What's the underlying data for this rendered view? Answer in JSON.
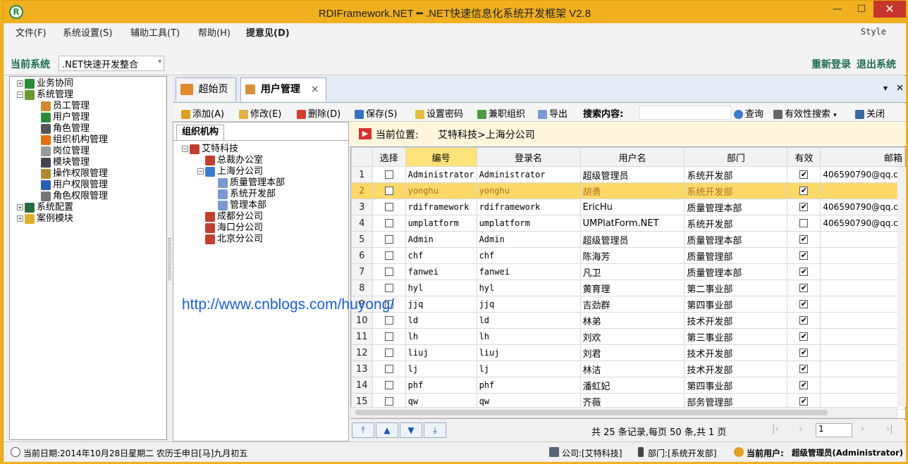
{
  "window": {
    "title": "RDIFramework.NET ━ .NET快速信息化系统开发框架 V2.8",
    "close": "✕",
    "minimize": "—",
    "maximize": "☐"
  },
  "menu": {
    "items": [
      "文件(F)",
      "系统设置(S)",
      "辅助工具(T)",
      "帮助(H)",
      "提意见(D)"
    ],
    "style": "Style"
  },
  "system": {
    "label": "当前系统",
    "selected": ".NET快速开发整合",
    "relogin": "重新登录",
    "exit": "退出系统"
  },
  "nav_tree": {
    "items": [
      {
        "label": "业务协同",
        "level": 0,
        "exp": "+",
        "color": "#2a8a3a"
      },
      {
        "label": "系统管理",
        "level": 0,
        "exp": "−",
        "color": "#6a9a30"
      },
      {
        "label": "员工管理",
        "level": 1,
        "color": "#d08a30"
      },
      {
        "label": "用户管理",
        "level": 1,
        "color": "#2a8a3a"
      },
      {
        "label": "角色管理",
        "level": 1,
        "color": "#555"
      },
      {
        "label": "组织机构管理",
        "level": 1,
        "color": "#e07010"
      },
      {
        "label": "岗位管理",
        "level": 1,
        "color": "#999"
      },
      {
        "label": "模块管理",
        "level": 1,
        "color": "#445"
      },
      {
        "label": "操作权限管理",
        "level": 1,
        "color": "#b08830"
      },
      {
        "label": "用户权限管理",
        "level": 1,
        "color": "#2a5fb0"
      },
      {
        "label": "角色权限管理",
        "level": 1,
        "color": "#777"
      },
      {
        "label": "系统配置",
        "level": 0,
        "exp": "+",
        "color": "#2a6a40"
      },
      {
        "label": "案例模块",
        "level": 0,
        "exp": "+",
        "color": "#e0b030"
      }
    ]
  },
  "tabs": {
    "home": "超始页",
    "active": "用户管理",
    "close": "×",
    "dropdown": "▾",
    "close_all": "✕"
  },
  "toolbar": {
    "add": "添加(A)",
    "edit": "修改(E)",
    "delete": "删除(D)",
    "save": "保存(S)",
    "setpwd": "设置密码",
    "parttime": "兼职组织",
    "export": "导出",
    "search_label": "搜索内容:",
    "search_value": "",
    "query": "查询",
    "valid_search": "有效性搜索",
    "close": "关闭"
  },
  "org": {
    "tab": "组织机构",
    "items": [
      {
        "label": "艾特科技",
        "level": 0,
        "exp": "−"
      },
      {
        "label": "总裁办公室",
        "level": 1
      },
      {
        "label": "上海分公司",
        "level": 1,
        "exp": "−"
      },
      {
        "label": "质量管理本部",
        "level": 2
      },
      {
        "label": "系统开发部",
        "level": 2
      },
      {
        "label": "管理本部",
        "level": 2
      },
      {
        "label": "成都分公司",
        "level": 1
      },
      {
        "label": "海口分公司",
        "level": 1
      },
      {
        "label": "北京分公司",
        "level": 1
      }
    ]
  },
  "location": {
    "label": "当前位置:",
    "path": "艾特科技>上海分公司"
  },
  "grid": {
    "headers": [
      "选择",
      "编号",
      "登录名",
      "用户名",
      "部门",
      "有效",
      "邮箱"
    ],
    "rows": [
      {
        "n": "1",
        "code": "Administrator",
        "login": "Administrator",
        "name": "超级管理员",
        "dept": "系统开发部",
        "valid": true,
        "email": "406590790@qq.c"
      },
      {
        "n": "2",
        "code": "yonghu",
        "login": "yonghu",
        "name": "胡勇",
        "dept": "系统开发部",
        "valid": true,
        "email": "",
        "sel": true
      },
      {
        "n": "3",
        "code": "rdiframework",
        "login": "rdiframework",
        "name": "EricHu",
        "dept": "质量管理本部",
        "valid": true,
        "email": "406590790@qq.c"
      },
      {
        "n": "4",
        "code": "umplatform",
        "login": "umplatform",
        "name": "UMPlatForm.NET",
        "dept": "系统开发部",
        "valid": false,
        "email": "406590790@qq.c"
      },
      {
        "n": "5",
        "code": "Admin",
        "login": "Admin",
        "name": "超级管理员",
        "dept": "质量管理本部",
        "valid": true,
        "email": ""
      },
      {
        "n": "6",
        "code": "chf",
        "login": "chf",
        "name": "陈海芳",
        "dept": "质量管理部",
        "valid": true,
        "email": ""
      },
      {
        "n": "7",
        "code": "fanwei",
        "login": "fanwei",
        "name": "凡卫",
        "dept": "质量管理本部",
        "valid": true,
        "email": ""
      },
      {
        "n": "8",
        "code": "hyl",
        "login": "hyl",
        "name": "黄育理",
        "dept": "第二事业部",
        "valid": true,
        "email": ""
      },
      {
        "n": "9",
        "code": "jjq",
        "login": "jjq",
        "name": "吉劲群",
        "dept": "第四事业部",
        "valid": true,
        "email": ""
      },
      {
        "n": "10",
        "code": "ld",
        "login": "ld",
        "name": "林弟",
        "dept": "技术开发部",
        "valid": true,
        "email": ""
      },
      {
        "n": "11",
        "code": "lh",
        "login": "lh",
        "name": "刘欢",
        "dept": "第三事业部",
        "valid": true,
        "email": ""
      },
      {
        "n": "12",
        "code": "liuj",
        "login": "liuj",
        "name": "刘君",
        "dept": "技术开发部",
        "valid": true,
        "email": ""
      },
      {
        "n": "13",
        "code": "lj",
        "login": "lj",
        "name": "林洁",
        "dept": "技术开发部",
        "valid": true,
        "email": ""
      },
      {
        "n": "14",
        "code": "phf",
        "login": "phf",
        "name": "潘虹妃",
        "dept": "第四事业部",
        "valid": true,
        "email": ""
      },
      {
        "n": "15",
        "code": "qw",
        "login": "qw",
        "name": "齐薇",
        "dept": "部务管理部",
        "valid": true,
        "email": ""
      }
    ]
  },
  "pager": {
    "summary": "共 25 条记录,每页 50 条,共 1 页",
    "page": "1"
  },
  "status": {
    "date": "当前日期:2014年10月28日星期二 农历壬申日[马]九月初五",
    "company": "公司:[艾特科技]",
    "dept": "部门:[系统开发部]",
    "user_label": "当前用户:",
    "user": "超级管理员(Administrator)"
  },
  "watermark": "http://www.cnblogs.com/huyong/"
}
